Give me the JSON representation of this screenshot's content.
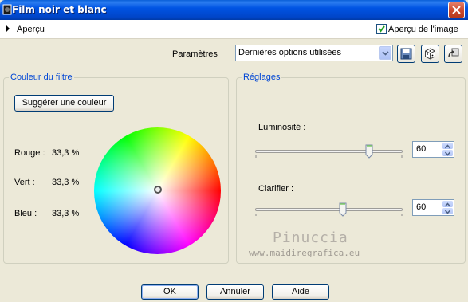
{
  "window": {
    "title": "Film noir et blanc",
    "icons": [
      "app-icon",
      "close-icon"
    ]
  },
  "preview": {
    "label": "Aperçu",
    "image_preview_label": "Aperçu de l'image",
    "image_preview_checked": true
  },
  "params": {
    "label": "Paramètres",
    "selected": "Dernières options utilisées",
    "icons": [
      "save-icon",
      "dice-icon",
      "reset-icon"
    ]
  },
  "filter_color": {
    "group_title": "Couleur du filtre",
    "suggest_button": "Suggérer une couleur",
    "red_label": "Rouge :",
    "red_value": "33,3 %",
    "green_label": "Vert :",
    "green_value": "33,3 %",
    "blue_label": "Bleu :",
    "blue_value": "33,3 %"
  },
  "settings": {
    "group_title": "Réglages",
    "brightness_label": "Luminosité :",
    "brightness_value": "60",
    "clarify_label": "Clarifier :",
    "clarify_value": "60"
  },
  "watermark": {
    "name": "Pinuccia",
    "url": "www.maidiregrafica.eu"
  },
  "buttons": {
    "ok": "OK",
    "cancel": "Annuler",
    "help": "Aide"
  },
  "colors": {
    "title_bar": "#0054e3",
    "dialog_bg": "#ece9d8",
    "group_title": "#0046d5",
    "close_button": "#cc4a2e"
  }
}
